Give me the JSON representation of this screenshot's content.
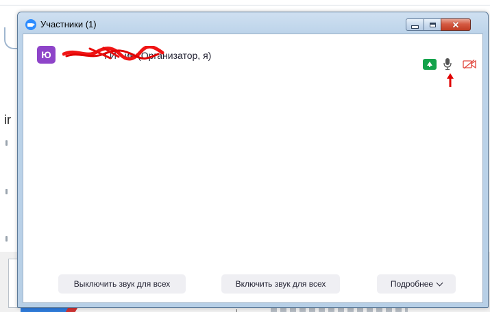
{
  "window": {
    "title": "Участники (1)"
  },
  "participant": {
    "avatar_letter": "Ю",
    "name_visible": "               ГИ   ин (Организатор, я)",
    "avatar_color": "#8e44c9"
  },
  "footer": {
    "mute_all_label": "Выключить звук для всех",
    "unmute_all_label": "Включить звук для всех",
    "more_label": "Подробнее"
  },
  "background": {
    "partial_text": "ir"
  },
  "colors": {
    "share_green": "#13a24a",
    "video_off_red": "#e0453b",
    "zoom_blue": "#2d8cff"
  }
}
